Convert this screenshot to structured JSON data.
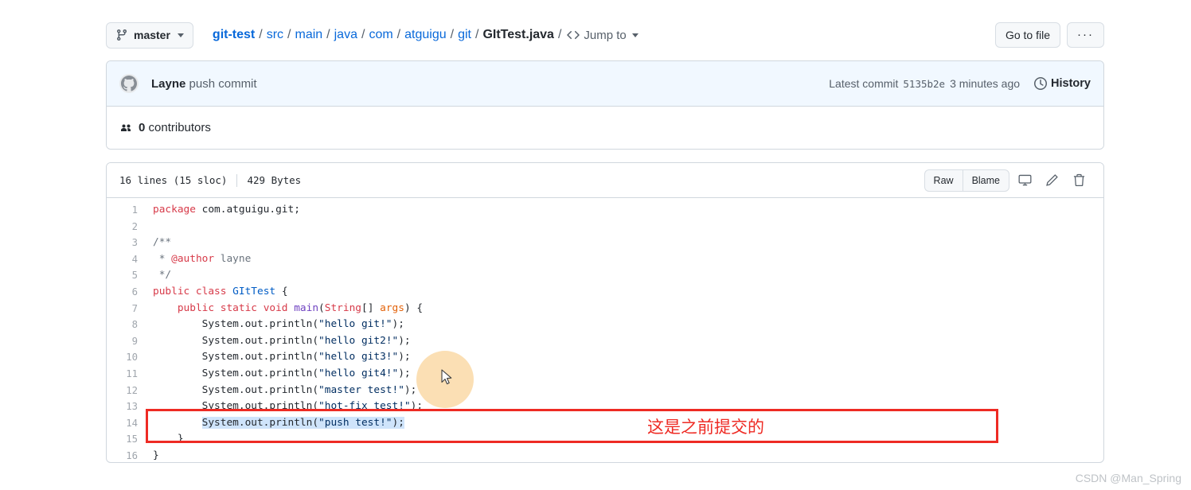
{
  "topbar": {
    "branch": {
      "label": "master",
      "icon": "git-branch-icon"
    },
    "breadcrumb": {
      "repo": "git-test",
      "segments": [
        "src",
        "main",
        "java",
        "com",
        "atguigu",
        "git"
      ],
      "file": "GItTest.java",
      "jump_to": "Jump to"
    },
    "go_to_file": "Go to file",
    "overflow": "···"
  },
  "commit": {
    "author": "Layne",
    "message": "push commit",
    "latest_commit_label": "Latest commit",
    "sha": "5135b2e",
    "time": "3 minutes ago",
    "history": "History"
  },
  "contributors": {
    "count": "0",
    "label": "contributors"
  },
  "file": {
    "lines_meta": "16 lines (15 sloc)",
    "size": "429 Bytes",
    "actions": {
      "raw": "Raw",
      "blame": "Blame",
      "open_desktop": "open-in-desktop-icon",
      "edit": "edit-pencil-icon",
      "delete": "trash-icon"
    }
  },
  "code": {
    "lines": [
      {
        "n": "1",
        "tokens": [
          {
            "t": "package ",
            "c": "k"
          },
          {
            "t": "com.atguigu.git;",
            "c": ""
          }
        ]
      },
      {
        "n": "2",
        "tokens": []
      },
      {
        "n": "3",
        "tokens": [
          {
            "t": "/**",
            "c": "c"
          }
        ]
      },
      {
        "n": "4",
        "tokens": [
          {
            "t": " * ",
            "c": "c"
          },
          {
            "t": "@author",
            "c": "a"
          },
          {
            "t": " layne",
            "c": "c"
          }
        ]
      },
      {
        "n": "5",
        "tokens": [
          {
            "t": " */",
            "c": "c"
          }
        ]
      },
      {
        "n": "6",
        "tokens": [
          {
            "t": "public class ",
            "c": "k"
          },
          {
            "t": "GItTest",
            "c": "cn"
          },
          {
            "t": " {",
            "c": ""
          }
        ]
      },
      {
        "n": "7",
        "tokens": [
          {
            "t": "    ",
            "c": ""
          },
          {
            "t": "public static void ",
            "c": "k"
          },
          {
            "t": "main",
            "c": "t"
          },
          {
            "t": "(",
            "c": ""
          },
          {
            "t": "String",
            "c": "k"
          },
          {
            "t": "[] ",
            "c": ""
          },
          {
            "t": "args",
            "c": "p"
          },
          {
            "t": ") {",
            "c": ""
          }
        ]
      },
      {
        "n": "8",
        "tokens": [
          {
            "t": "        System.out.println(",
            "c": ""
          },
          {
            "t": "\"hello git!\"",
            "c": "s"
          },
          {
            "t": ");",
            "c": ""
          }
        ]
      },
      {
        "n": "9",
        "tokens": [
          {
            "t": "        System.out.println(",
            "c": ""
          },
          {
            "t": "\"hello git2!\"",
            "c": "s"
          },
          {
            "t": ");",
            "c": ""
          }
        ]
      },
      {
        "n": "10",
        "tokens": [
          {
            "t": "        System.out.println(",
            "c": ""
          },
          {
            "t": "\"hello git3!\"",
            "c": "s"
          },
          {
            "t": ");",
            "c": ""
          }
        ]
      },
      {
        "n": "11",
        "tokens": [
          {
            "t": "        System.out.println(",
            "c": ""
          },
          {
            "t": "\"hello git4!\"",
            "c": "s"
          },
          {
            "t": ");",
            "c": ""
          }
        ]
      },
      {
        "n": "12",
        "tokens": [
          {
            "t": "        System.out.println(",
            "c": ""
          },
          {
            "t": "\"master test!\"",
            "c": "s"
          },
          {
            "t": ");",
            "c": ""
          }
        ]
      },
      {
        "n": "13",
        "tokens": [
          {
            "t": "        System.out.println(",
            "c": ""
          },
          {
            "t": "\"hot-fix test!\"",
            "c": "s"
          },
          {
            "t": ");",
            "c": ""
          }
        ]
      },
      {
        "n": "14",
        "selected": true,
        "tokens": [
          {
            "t": "        ",
            "c": ""
          },
          {
            "t": "System.out.println(",
            "c": ""
          },
          {
            "t": "\"push test!\"",
            "c": "s"
          },
          {
            "t": ");",
            "c": ""
          }
        ]
      },
      {
        "n": "15",
        "tokens": [
          {
            "t": "    }",
            "c": ""
          }
        ]
      },
      {
        "n": "16",
        "tokens": [
          {
            "t": "}",
            "c": ""
          }
        ]
      }
    ]
  },
  "annotation": {
    "text": "这是之前提交的",
    "color": "#ee2b24"
  },
  "watermark": "CSDN @Man_Spring",
  "colors": {
    "accent": "#0969da",
    "commit_bg": "#f1f8ff",
    "border": "#d0d7de",
    "selection": "#cfe4fb",
    "cursor_halo": "#fbdfb4"
  }
}
